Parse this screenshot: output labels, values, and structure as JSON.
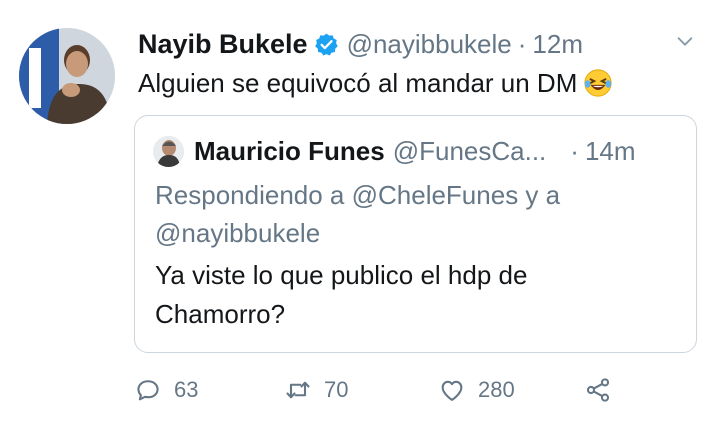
{
  "tweet": {
    "author_name": "Nayib Bukele",
    "handle": "@nayibbukele",
    "dot": "·",
    "time": "12m",
    "text": "Alguien se equivocó al mandar un DM",
    "emoji": "laughing-emoji"
  },
  "quoted": {
    "author_name": "Mauricio Funes",
    "handle": "@FunesCa...",
    "dot": "·",
    "time": "14m",
    "reply_line1": "Respondiendo a @CheleFunes y a",
    "reply_line2": "@nayibbukele",
    "text_line1": "Ya viste lo que publico el hdp de",
    "text_line2": "Chamorro?"
  },
  "actions": {
    "replies": "63",
    "retweets": "70",
    "likes": "280"
  },
  "colors": {
    "verified": "#1da1f2",
    "secondary_text": "#657786",
    "border": "#cdd6de"
  }
}
